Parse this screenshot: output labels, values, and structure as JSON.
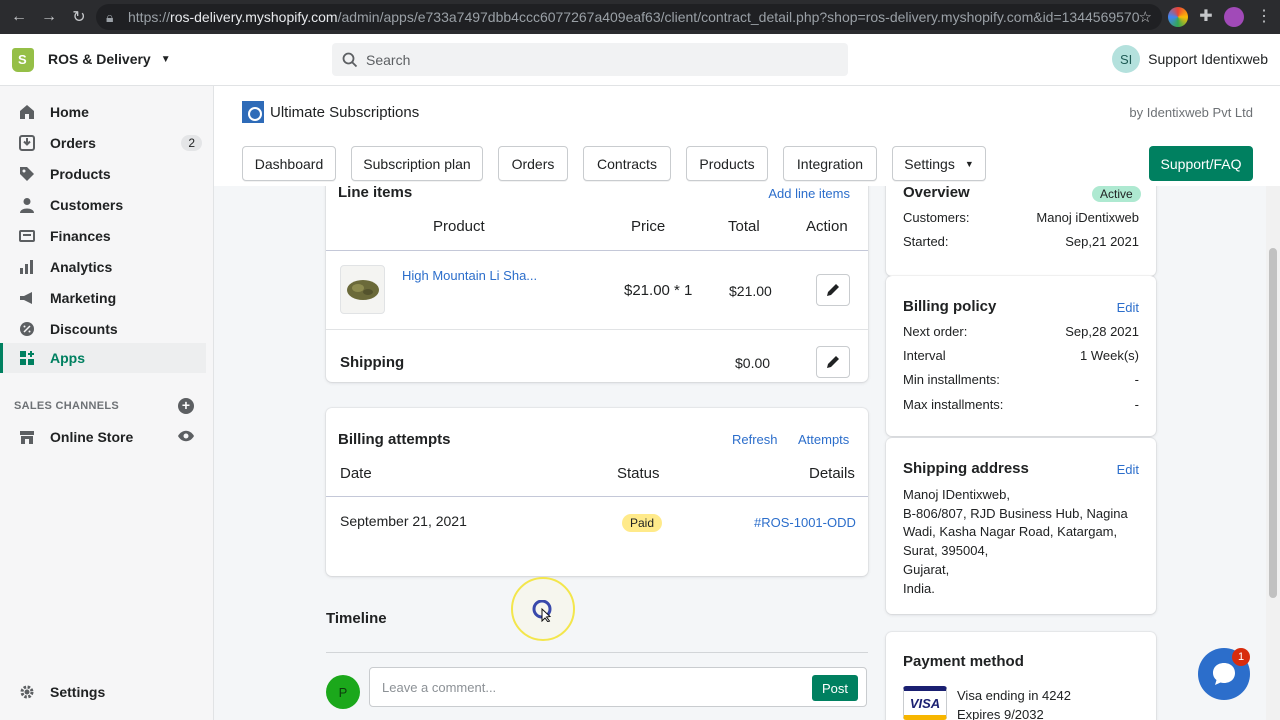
{
  "browser": {
    "url_host": "ros-delivery.myshopify.com",
    "url_path": "/admin/apps/e733a7497dbb4ccc6077267a409eaf63/client/contract_detail.php?shop=ros-delivery.myshopify.com&id=1344569570",
    "url_scheme": "https://"
  },
  "topbar": {
    "store_name": "ROS & Delivery",
    "search_placeholder": "Search",
    "avatar_initials": "SI",
    "user_name": "Support Identixweb"
  },
  "sidebar": {
    "items": [
      {
        "label": "Home",
        "icon": "home-icon"
      },
      {
        "label": "Orders",
        "icon": "orders-icon",
        "badge": "2"
      },
      {
        "label": "Products",
        "icon": "tag-icon"
      },
      {
        "label": "Customers",
        "icon": "person-icon"
      },
      {
        "label": "Finances",
        "icon": "finance-icon"
      },
      {
        "label": "Analytics",
        "icon": "bar-chart-icon"
      },
      {
        "label": "Marketing",
        "icon": "megaphone-icon"
      },
      {
        "label": "Discounts",
        "icon": "discount-icon"
      },
      {
        "label": "Apps",
        "icon": "apps-icon",
        "active": true
      }
    ],
    "sales_channels_label": "SALES CHANNELS",
    "online_store": "Online Store",
    "settings": "Settings"
  },
  "app": {
    "title": "Ultimate Subscriptions",
    "by": "by Identixweb Pvt Ltd",
    "tabs": [
      "Dashboard",
      "Subscription plan",
      "Orders",
      "Contracts",
      "Products",
      "Integration",
      "Settings"
    ],
    "support_label": "Support/FAQ"
  },
  "line_items": {
    "title": "Line items",
    "add_link": "Add line items",
    "headers": {
      "product": "Product",
      "price": "Price",
      "total": "Total",
      "action": "Action"
    },
    "product_name": "High Mountain Li Sha...",
    "price": "$21.00 * 1",
    "total": "$21.00",
    "shipping_label": "Shipping",
    "shipping_value": "$0.00"
  },
  "billing_attempts": {
    "title": "Billing attempts",
    "refresh": "Refresh",
    "attempts": "Attempts",
    "headers": {
      "date": "Date",
      "status": "Status",
      "details": "Details"
    },
    "rows": [
      {
        "date": "September 21, 2021",
        "status": "Paid",
        "details": "#ROS-1001-ODD"
      }
    ]
  },
  "timeline": {
    "title": "Timeline",
    "avatar": "P",
    "placeholder": "Leave a comment...",
    "post": "Post"
  },
  "overview": {
    "title": "Overview",
    "status": "Active",
    "customers_label": "Customers:",
    "customers_value": "Manoj iDentixweb",
    "started_label": "Started:",
    "started_value": "Sep,21 2021"
  },
  "billing_policy": {
    "title": "Billing policy",
    "edit": "Edit",
    "rows": [
      {
        "label": "Next order:",
        "value": "Sep,28 2021"
      },
      {
        "label": "Interval",
        "value": "1 Week(s)"
      },
      {
        "label": "Min installments:",
        "value": "-"
      },
      {
        "label": "Max installments:",
        "value": "-"
      }
    ]
  },
  "shipping_address": {
    "title": "Shipping address",
    "edit": "Edit",
    "lines": [
      "Manoj IDentixweb,",
      "B-806/807, RJD Business Hub, Nagina",
      "Wadi, Kasha Nagar Road, Katargam,",
      "Surat, 395004,",
      "Gujarat,",
      "India."
    ]
  },
  "payment": {
    "title": "Payment method",
    "card_brand": "VISA",
    "card_text": "Visa ending in 4242",
    "expires": "Expires 9/2032"
  },
  "chat_badge": "1",
  "colors": {
    "primary": "#008060",
    "link": "#2c6ecb",
    "active_badge": "#aee9d1",
    "paid_badge": "#ffea8a"
  }
}
